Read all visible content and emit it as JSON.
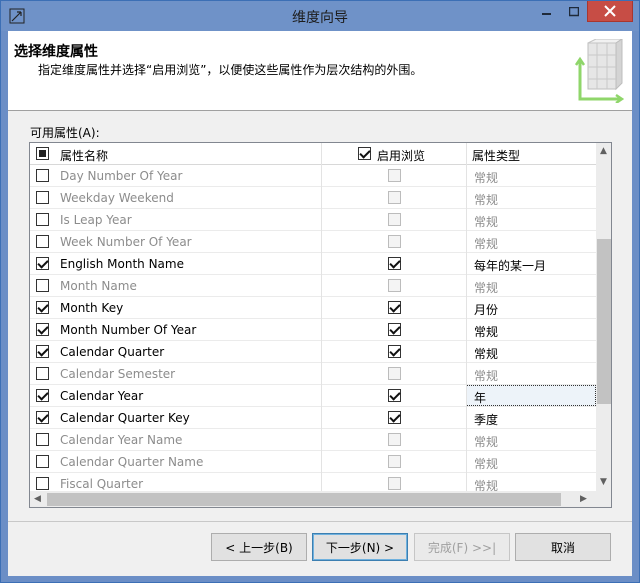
{
  "window": {
    "title": "维度向导"
  },
  "header": {
    "title": "选择维度属性",
    "description": "指定维度属性并选择“启用浏览”，以便使这些属性作为层次结构的外围。"
  },
  "grid": {
    "label": "可用属性(A):",
    "columns": {
      "name": "属性名称",
      "browse": "启用浏览",
      "type": "属性类型"
    },
    "rows": [
      {
        "name": "Day Number Of Year",
        "checked": false,
        "browse": false,
        "type": "常规",
        "enabled": false
      },
      {
        "name": "Weekday Weekend",
        "checked": false,
        "browse": false,
        "type": "常规",
        "enabled": false
      },
      {
        "name": "Is Leap Year",
        "checked": false,
        "browse": false,
        "type": "常规",
        "enabled": false
      },
      {
        "name": "Week Number Of Year",
        "checked": false,
        "browse": false,
        "type": "常规",
        "enabled": false
      },
      {
        "name": "English Month Name",
        "checked": true,
        "browse": true,
        "type": "每年的某一月",
        "enabled": true
      },
      {
        "name": "Month Name",
        "checked": false,
        "browse": false,
        "type": "常规",
        "enabled": false
      },
      {
        "name": "Month Key",
        "checked": true,
        "browse": true,
        "type": "月份",
        "enabled": true
      },
      {
        "name": "Month Number Of Year",
        "checked": true,
        "browse": true,
        "type": "常规",
        "enabled": true
      },
      {
        "name": "Calendar Quarter",
        "checked": true,
        "browse": true,
        "type": "常规",
        "enabled": true
      },
      {
        "name": "Calendar Semester",
        "checked": false,
        "browse": false,
        "type": "常规",
        "enabled": false
      },
      {
        "name": "Calendar Year",
        "checked": true,
        "browse": true,
        "type": "年",
        "enabled": true,
        "selected": true
      },
      {
        "name": "Calendar Quarter Key",
        "checked": true,
        "browse": true,
        "type": "季度",
        "enabled": true
      },
      {
        "name": "Calendar Year Name",
        "checked": false,
        "browse": false,
        "type": "常规",
        "enabled": false
      },
      {
        "name": "Calendar Quarter Name",
        "checked": false,
        "browse": false,
        "type": "常规",
        "enabled": false
      },
      {
        "name": "Fiscal Quarter",
        "checked": false,
        "browse": false,
        "type": "常规",
        "enabled": false
      }
    ]
  },
  "buttons": {
    "back": "< 上一步(B)",
    "next": "下一步(N) >",
    "finish": "完成(F) >>|",
    "cancel": "取消"
  }
}
